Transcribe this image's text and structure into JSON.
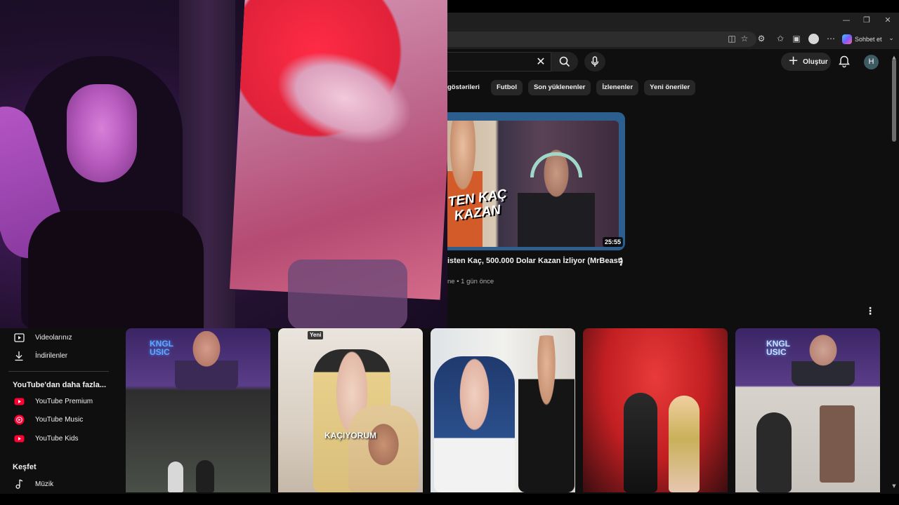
{
  "browser": {
    "window_controls": {
      "minimize": "—",
      "restore": "❐",
      "close": "✕"
    },
    "copilot_label": "Sohbet et",
    "toolbar_icons": [
      "split-screen-icon",
      "favorite-star-icon",
      "extensions-icon",
      "favorites-icon",
      "collections-icon",
      "profile-icon",
      "more-icon"
    ]
  },
  "header": {
    "clear_search": "✕",
    "create_label": "Oluştur",
    "create_plus": "+",
    "avatar_letter": "H"
  },
  "chips": [
    "göstərileri",
    "Futbol",
    "Son yüklenenler",
    "İzlenenler",
    "Yeni öneriler"
  ],
  "featured": {
    "thumbnail_text_line1": "TEN KAÇ",
    "thumbnail_text_line2": "KAZAN",
    "duration": "25:55",
    "title": "isten Kaç, 500.000 Dolar Kazan İzliyor (MrBeast)",
    "meta": "ne • 1 gün önce",
    "more": "⋮"
  },
  "shorts": {
    "more": "⋮",
    "items": [
      {
        "overlay": "KNGL\nUSIC"
      },
      {
        "caption": "KAÇIYORUM"
      },
      {
        "badge": "Yeni"
      },
      {},
      {
        "overlay": "KNGL\nUSIC"
      }
    ]
  },
  "sidebar": {
    "items_top": [
      {
        "label": "Videolarınız",
        "icon": "play-square-icon"
      },
      {
        "label": "İndirilenler",
        "icon": "download-icon"
      }
    ],
    "more_heading": "YouTube'dan daha fazla...",
    "more_items": [
      {
        "label": "YouTube Premium",
        "icon": "youtube-premium-icon",
        "color": "#ff0033"
      },
      {
        "label": "YouTube Music",
        "icon": "youtube-music-icon",
        "color": "#ff0033"
      },
      {
        "label": "YouTube Kids",
        "icon": "youtube-kids-icon",
        "color": "#ff0033"
      }
    ],
    "explore_heading": "Keşfet",
    "explore_items": [
      {
        "label": "Müzik",
        "icon": "music-note-icon"
      }
    ]
  },
  "colors": {
    "background": "#0f0f0f",
    "chip": "#272727",
    "featured_border": "#2c5f8e",
    "youtube_red": "#ff0033"
  }
}
